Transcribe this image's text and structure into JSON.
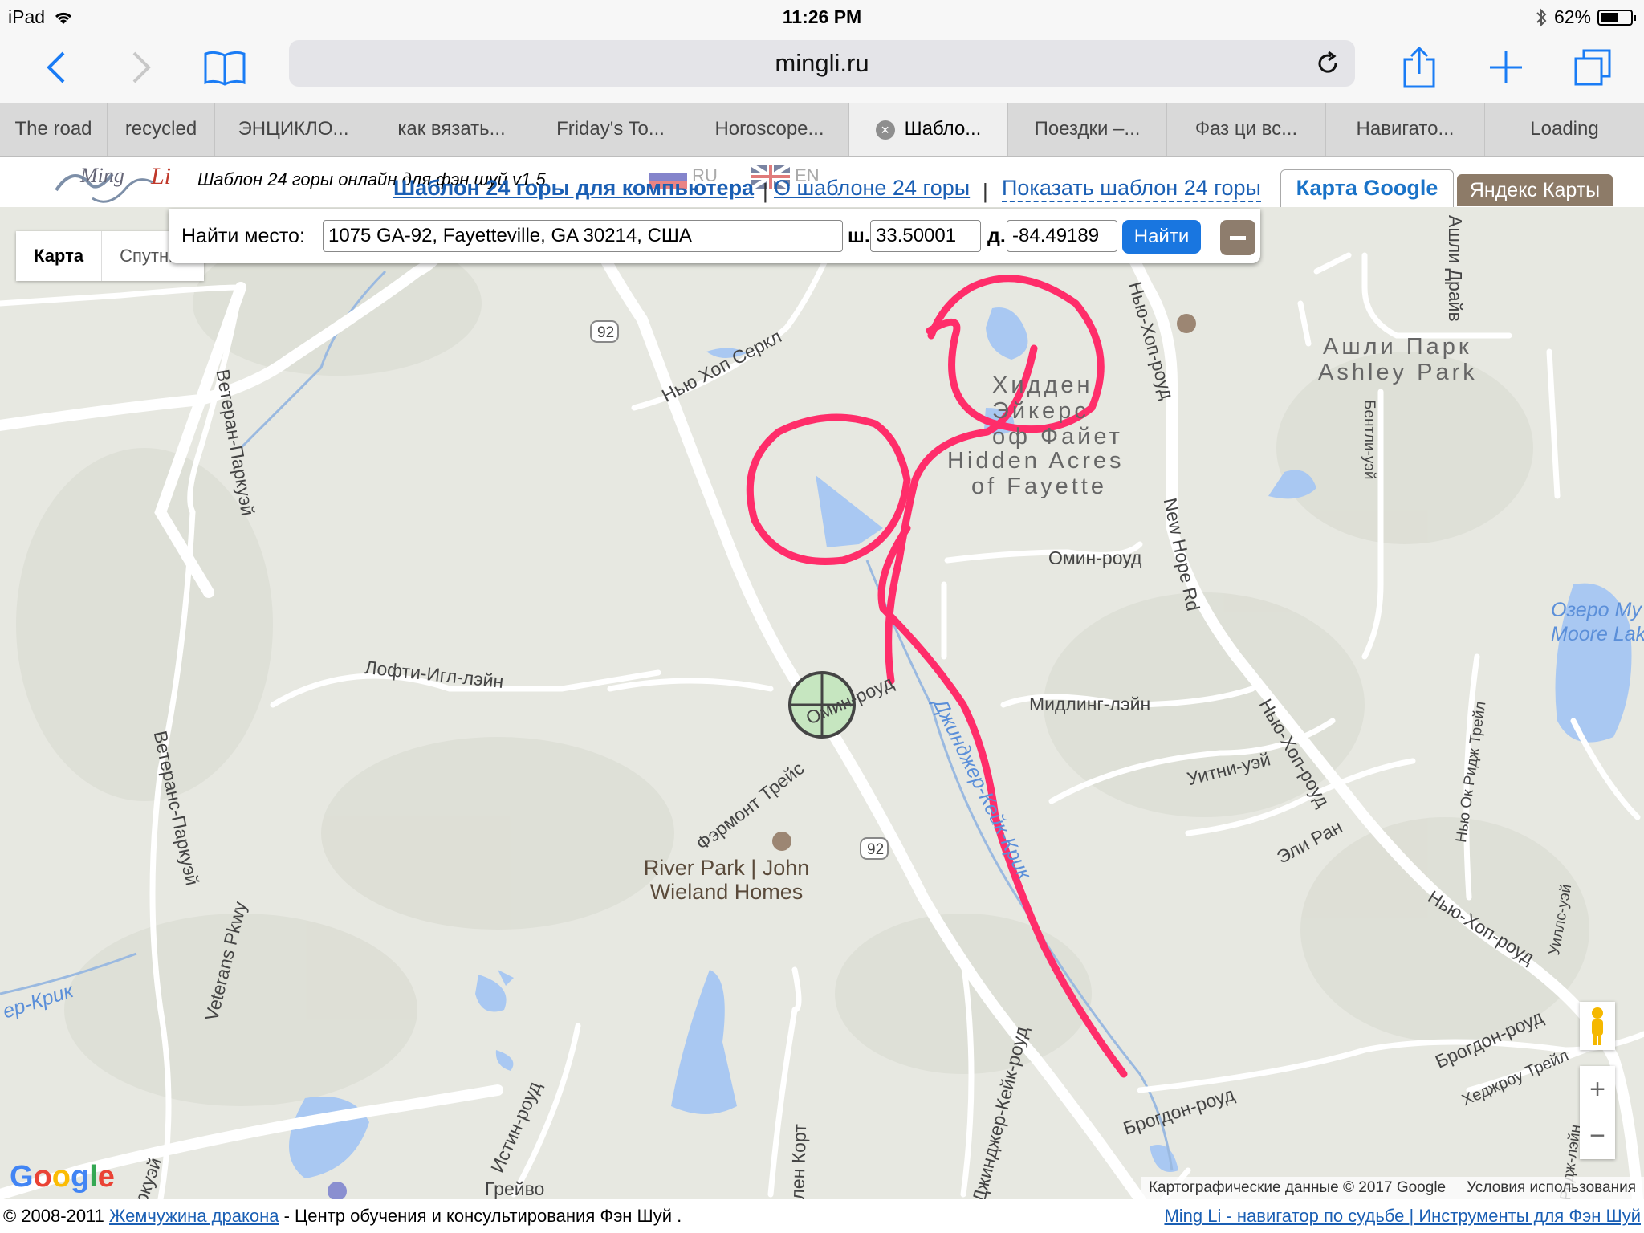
{
  "status": {
    "device": "iPad",
    "time": "11:26 PM",
    "battery": "62%",
    "battery_level": 0.62
  },
  "browser": {
    "url": "mingli.ru",
    "tabs": [
      "The road",
      "recycled",
      "ЭНЦИКЛО...",
      "как вязать...",
      "Friday's To...",
      "Horoscope...",
      "Шабло...",
      "Поездки –...",
      "Фаз ци вс...",
      "Навигато...",
      "Loading"
    ],
    "active_tab": 6
  },
  "site": {
    "title": "Шаблон 24 горы онлайн для фэн шуй v1.5",
    "lang_ru": "RU",
    "lang_en": "EN",
    "link_computer": "Шаблон 24 горы для компьютера",
    "link_about": "О шаблоне 24 горы",
    "link_show": "Показать шаблон 24 горы",
    "tab_google": "Карта Google",
    "tab_yandex": "Яндекс Карты"
  },
  "search": {
    "label": "Найти место:",
    "value": "1075 GA-92, Fayetteville, GA 30214, США",
    "lat_label": "ш.",
    "lat": "33.50001",
    "lon_label": "д.",
    "lon": "-84.49189",
    "find": "Найти"
  },
  "map": {
    "type_map": "Карта",
    "type_sat": "Спутник",
    "google": "Google",
    "attribution": "Картографические данные © 2017 Google",
    "terms": "Условия использования",
    "labels": {
      "veteran_top": "Ветеран-Паркуэй",
      "veteran_mid": "Ветеранс-Паркуэй",
      "veterans_pkwy": "Veterans Pkwy",
      "new_hope_circle": "Нью Хоп Серкл",
      "hidden_ru_1": "Хидден",
      "hidden_ru_2": "Эйкерс",
      "hidden_ru_3": "оф Файет",
      "hidden_en_1": "Hidden Acres",
      "hidden_en_2": "of Fayette",
      "ashley_ru": "Ашли Парк",
      "ashley_en": "Ashley Park",
      "ashley_drive": "Ашли Драйв",
      "new_hope_road_top": "Нью-Хоп-роуд",
      "new_hope_rd": "New Hope Rd",
      "new_hope_road_mid": "Нью-Хоп-роуд",
      "new_hope_road_low": "Нью-Хоп-роуд",
      "bentley": "Бентли-уэй",
      "omin_road_top": "Омин-роуд",
      "omin_road_mid": "Омин-роуд",
      "lofty": "Лофти-Игл-лэйн",
      "midling": "Мидлинг-лэйн",
      "ginger_creek": "Джинджер-Кейк-Крик",
      "whitney": "Уитни-уэй",
      "ali_ran": "Эли Ран",
      "fairmont": "Фэрмонт Трейс",
      "river_park": "River Park | John Wieland Homes",
      "lake": "Озеро Му",
      "lake_en": "Moore Lak",
      "new_oak": "Нью Ок Ридж Трейл",
      "wills": "Уиллс-уэй",
      "brogdon_road": "Брогдон-роуд",
      "brogdon_road2": "Брогдон-роуд",
      "hedgerow": "Хеджроу Трейл",
      "ginger_cake_road": "Джинджер-Кейк-роуд",
      "istin": "Истин-роуд",
      "len_court": "лен Корт",
      "creek_left": "ер-Крик",
      "parkway_bottom": "ркуэй",
      "grave": "Грейво",
      "ridge_bottom": "Ридж-лэйн",
      "route92": "92"
    }
  },
  "footer": {
    "copyright": "© 2008-2011",
    "link": "Жемчужина дракона",
    "rest": "- Центр обучения и консультирования Фэн Шуй .",
    "right": "Ming Li - навигатор по судьбе | Инструменты для Фэн Шуй"
  }
}
